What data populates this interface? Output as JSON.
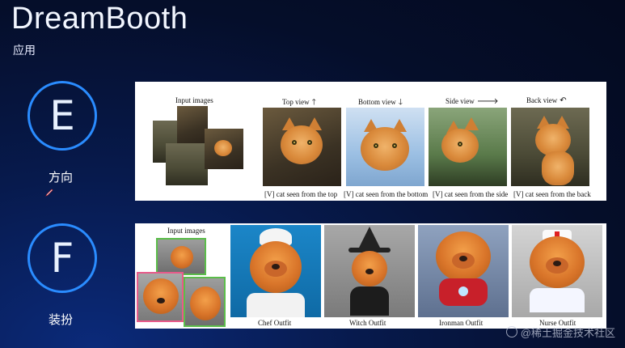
{
  "header": {
    "title": "DreamBooth",
    "subtitle": "应用"
  },
  "sections": [
    {
      "badge": "E",
      "label": "方向"
    },
    {
      "badge": "F",
      "label": "装扮"
    }
  ],
  "figure_e": {
    "input_label": "Input images",
    "views": [
      {
        "title": "Top view",
        "arrow": "🡑",
        "caption": "[V] cat seen from the top"
      },
      {
        "title": "Bottom view",
        "arrow": "🡓",
        "caption": "[V] cat seen from the bottom"
      },
      {
        "title": "Side view",
        "arrow": "🡒",
        "caption": "[V] cat seen from the side"
      },
      {
        "title": "Back view",
        "arrow": "↶",
        "caption": "[V] cat seen from the back"
      }
    ]
  },
  "figure_f": {
    "input_label": "Input images",
    "outfits": [
      {
        "caption": "Chef Outfit"
      },
      {
        "caption": "Witch Outfit"
      },
      {
        "caption": "Ironman Outfit"
      },
      {
        "caption": "Nurse Outfit"
      }
    ]
  },
  "watermark": {
    "text": "@稀土掘金技术社区"
  },
  "colors": {
    "badge_ring": "#2a8cff",
    "frame_green": "#5bbd4a",
    "frame_pink": "#e85a8a"
  }
}
